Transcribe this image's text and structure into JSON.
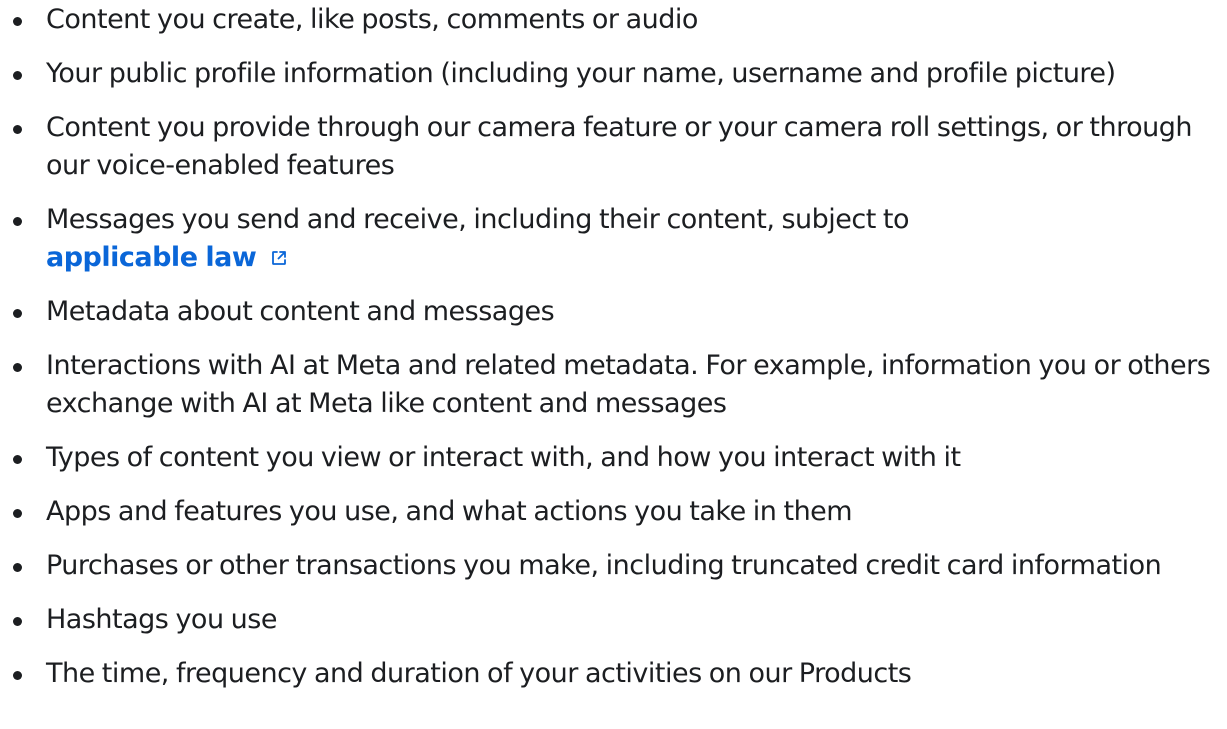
{
  "list": {
    "items": [
      {
        "text": "Content you create, like posts, comments or audio"
      },
      {
        "text": "Your public profile information (including your name, username and profile picture)"
      },
      {
        "text": "Content you provide through our camera feature or your camera roll settings, or through our voice-enabled features"
      },
      {
        "text": "Messages you send and receive, including their content, subject to",
        "link": "applicable law"
      },
      {
        "text": "Metadata about content and messages"
      },
      {
        "text": "Interactions with AI at Meta and related metadata. For example, information you or others exchange with AI at Meta like content and messages"
      },
      {
        "text": "Types of content you view or interact with, and how you interact with it"
      },
      {
        "text": "Apps and features you use, and what actions you take in them"
      },
      {
        "text": "Purchases or other transactions you make, including truncated credit card information"
      },
      {
        "text": "Hashtags you use"
      },
      {
        "text": "The time, frequency and duration of your activities on our Products"
      }
    ]
  },
  "colors": {
    "text": "#1c1e21",
    "link": "#0a66d8"
  },
  "icons": {
    "external_link": "external-link-icon",
    "bullet": "bullet-dot"
  }
}
